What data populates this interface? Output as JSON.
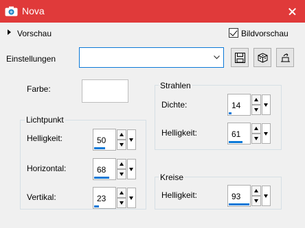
{
  "window": {
    "title": "Nova"
  },
  "preview": {
    "label": "Vorschau",
    "checkbox_label": "Bildvorschau",
    "checked": true
  },
  "settings": {
    "label": "Einstellungen",
    "value": ""
  },
  "farbe": {
    "label": "Farbe:",
    "color": "#ffffff"
  },
  "lichtpunkt": {
    "title": "Lichtpunkt",
    "helligkeit": {
      "label": "Helligkeit:",
      "value": "50",
      "fill": 0.5
    },
    "horizontal": {
      "label": "Horizontal:",
      "value": "68",
      "fill": 0.68
    },
    "vertikal": {
      "label": "Vertikal:",
      "value": "23",
      "fill": 0.23
    }
  },
  "strahlen": {
    "title": "Strahlen",
    "dichte": {
      "label": "Dichte:",
      "value": "14",
      "fill": 0.14
    },
    "helligkeit": {
      "label": "Helligkeit:",
      "value": "61",
      "fill": 0.61
    }
  },
  "kreise": {
    "title": "Kreise",
    "helligkeit": {
      "label": "Helligkeit:",
      "value": "93",
      "fill": 0.93
    }
  },
  "colors": {
    "titlebar": "#e03a3a",
    "accent": "#0a78d7"
  }
}
